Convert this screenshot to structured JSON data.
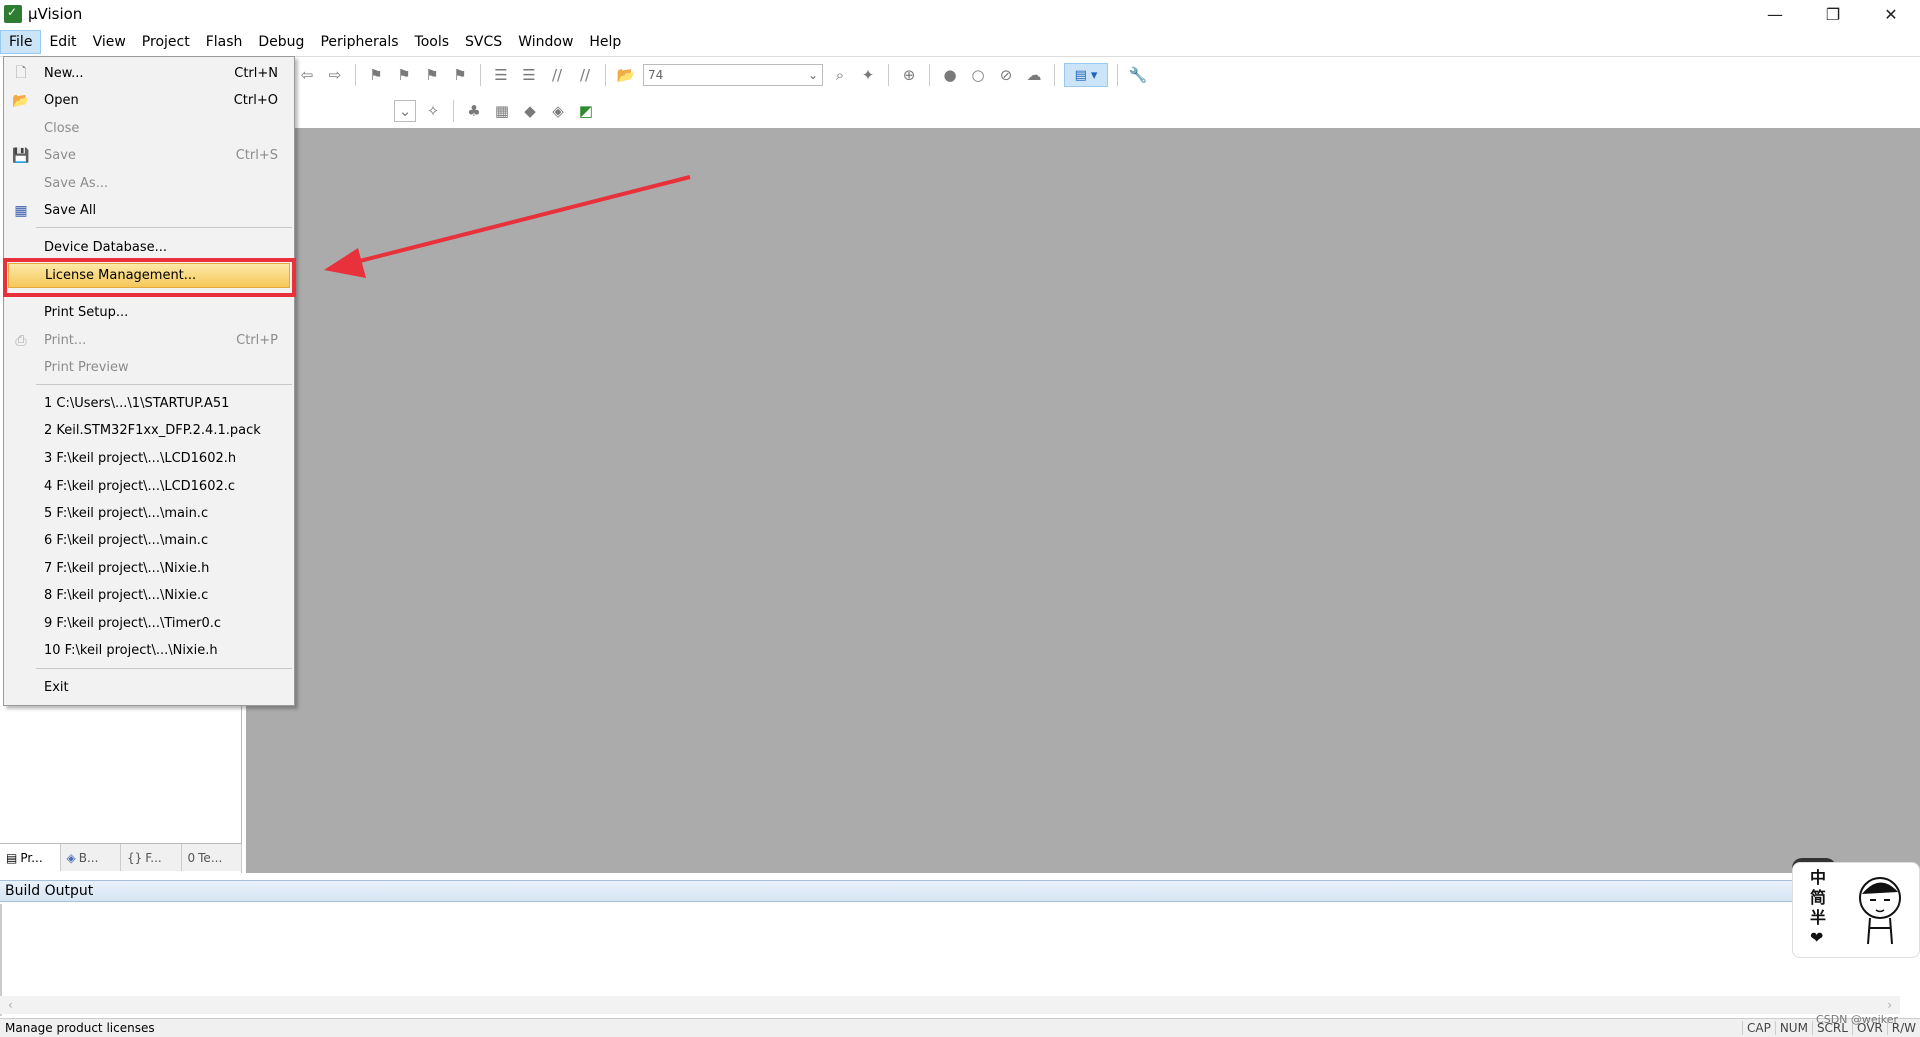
{
  "window": {
    "title": "µVision",
    "controls": [
      "—",
      "❐",
      "✕"
    ]
  },
  "menubar": {
    "items": [
      "File",
      "Edit",
      "View",
      "Project",
      "Flash",
      "Debug",
      "Peripherals",
      "Tools",
      "SVCS",
      "Window",
      "Help"
    ]
  },
  "toolbar": {
    "combo_value": "74"
  },
  "file_menu": {
    "items": [
      {
        "label": "New...",
        "shortcut": "Ctrl+N",
        "enabled": true,
        "icon": "new-file-icon"
      },
      {
        "label": "Open",
        "shortcut": "Ctrl+O",
        "enabled": true,
        "icon": "open-folder-icon"
      },
      {
        "label": "Close",
        "shortcut": "",
        "enabled": false
      },
      {
        "label": "Save",
        "shortcut": "Ctrl+S",
        "enabled": false,
        "icon": "save-icon"
      },
      {
        "label": "Save As...",
        "shortcut": "",
        "enabled": false
      },
      {
        "label": "Save All",
        "shortcut": "",
        "enabled": true,
        "icon": "save-all-icon"
      },
      {
        "label": "Device Database...",
        "shortcut": "",
        "enabled": true
      },
      {
        "label": "License Management...",
        "shortcut": "",
        "enabled": true,
        "highlighted": true
      },
      {
        "label": "Print Setup...",
        "shortcut": "",
        "enabled": true
      },
      {
        "label": "Print...",
        "shortcut": "Ctrl+P",
        "enabled": false,
        "icon": "print-icon"
      },
      {
        "label": "Print Preview",
        "shortcut": "",
        "enabled": false
      },
      {
        "label": "1 C:\\Users\\...\\1\\STARTUP.A51",
        "shortcut": "",
        "enabled": true
      },
      {
        "label": "2 Keil.STM32F1xx_DFP.2.4.1.pack",
        "shortcut": "",
        "enabled": true
      },
      {
        "label": "3 F:\\keil project\\...\\LCD1602.h",
        "shortcut": "",
        "enabled": true
      },
      {
        "label": "4 F:\\keil project\\...\\LCD1602.c",
        "shortcut": "",
        "enabled": true
      },
      {
        "label": "5 F:\\keil project\\...\\main.c",
        "shortcut": "",
        "enabled": true
      },
      {
        "label": "6 F:\\keil project\\...\\main.c",
        "shortcut": "",
        "enabled": true
      },
      {
        "label": "7 F:\\keil project\\...\\Nixie.h",
        "shortcut": "",
        "enabled": true
      },
      {
        "label": "8 F:\\keil project\\...\\Nixie.c",
        "shortcut": "",
        "enabled": true
      },
      {
        "label": "9 F:\\keil project\\...\\Timer0.c",
        "shortcut": "",
        "enabled": true
      },
      {
        "label": "10 F:\\keil project\\...\\Nixie.h",
        "shortcut": "",
        "enabled": true
      },
      {
        "label": "Exit",
        "shortcut": "",
        "enabled": true
      }
    ]
  },
  "project_panel": {
    "tabs": [
      "Pr...",
      "B...",
      "F...",
      "Te..."
    ]
  },
  "build_output": {
    "title": "Build Output"
  },
  "statusbar": {
    "text": "Manage product licenses",
    "flags": [
      "CAP",
      "NUM",
      "SCRL",
      "OVR",
      "R/W"
    ]
  },
  "watermark": "CSDN @weiker",
  "sticker": {
    "text": "中简半❤"
  },
  "colors": {
    "highlight": "#f5c85a",
    "annotation": "#e8313a",
    "editor_bg": "#ababab"
  }
}
